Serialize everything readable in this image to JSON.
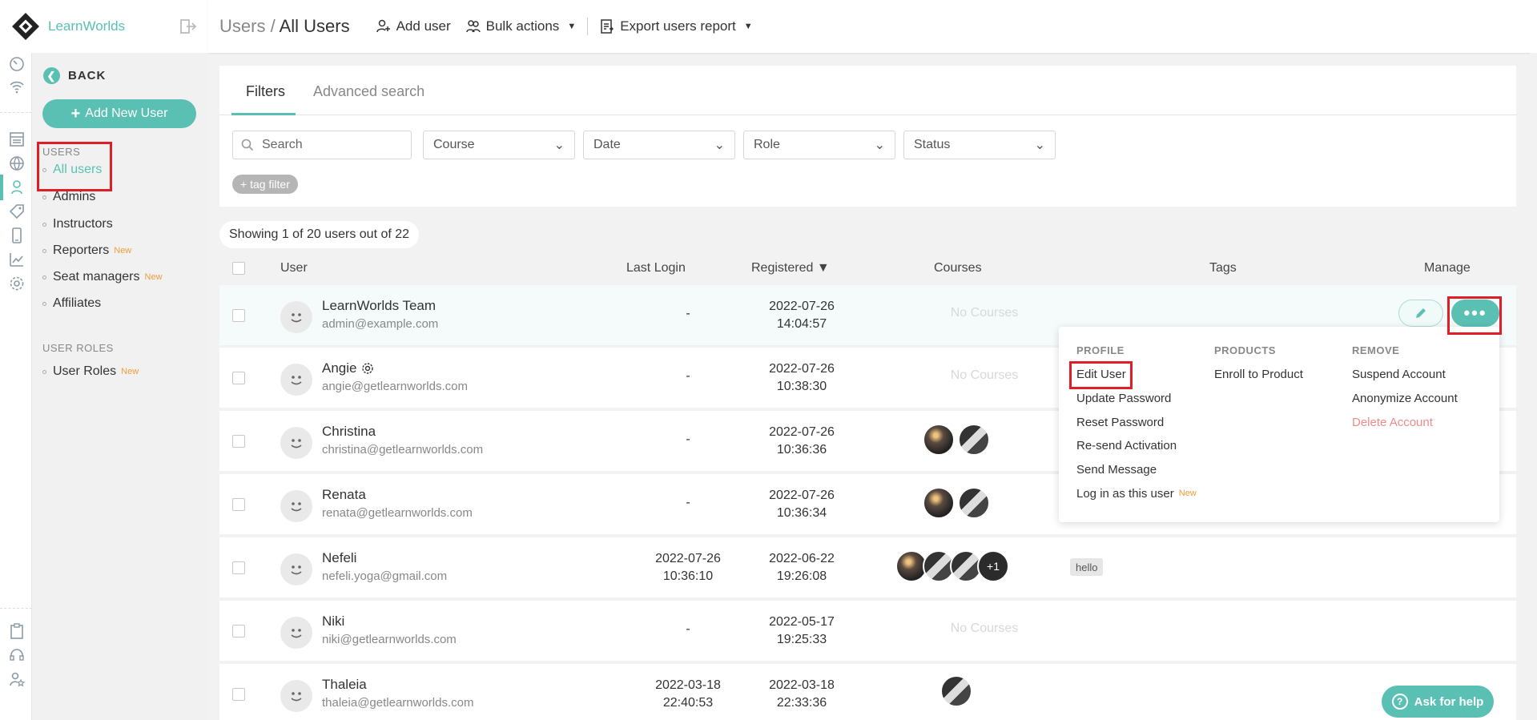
{
  "brand": {
    "name": "LearnWorlds"
  },
  "header": {
    "crumb_parent": "Users",
    "crumb_sep": " / ",
    "crumb_current": "All Users",
    "add_user": "Add user",
    "bulk_actions": "Bulk actions",
    "export_report": "Export users report"
  },
  "sidebar": {
    "back": "BACK",
    "add_new_user": "Add New User",
    "users_section": "USERS",
    "items": [
      {
        "label": "All users",
        "badge": ""
      },
      {
        "label": "Admins",
        "badge": ""
      },
      {
        "label": "Instructors",
        "badge": ""
      },
      {
        "label": "Reporters",
        "badge": "New"
      },
      {
        "label": "Seat managers",
        "badge": "New"
      },
      {
        "label": "Affiliates",
        "badge": ""
      }
    ],
    "roles_section": "USER ROLES",
    "roles_item": {
      "label": "User Roles",
      "badge": "New"
    }
  },
  "filters": {
    "tab_filters": "Filters",
    "tab_advanced": "Advanced search",
    "search_placeholder": "Search",
    "course": "Course",
    "date": "Date",
    "role": "Role",
    "status": "Status",
    "tag_filter": "+ tag filter"
  },
  "showing": "Showing 1 of 20 users out of 22",
  "table": {
    "columns": {
      "user": "User",
      "last_login": "Last Login",
      "registered": "Registered ▼",
      "courses": "Courses",
      "tags": "Tags",
      "manage": "Manage"
    },
    "no_courses": "No Courses",
    "rows": [
      {
        "name": "LearnWorlds Team",
        "email": "admin@example.com",
        "last_login_date": "-",
        "last_login_time": "",
        "reg_date": "2022-07-26",
        "reg_time": "14:04:57",
        "courses": 0,
        "tag": ""
      },
      {
        "name": "Angie",
        "email": "angie@getlearnworlds.com",
        "last_login_date": "-",
        "last_login_time": "",
        "reg_date": "2022-07-26",
        "reg_time": "10:38:30",
        "courses": 0,
        "tag": ""
      },
      {
        "name": "Christina",
        "email": "christina@getlearnworlds.com",
        "last_login_date": "-",
        "last_login_time": "",
        "reg_date": "2022-07-26",
        "reg_time": "10:36:36",
        "courses": 2,
        "tag": ""
      },
      {
        "name": "Renata",
        "email": "renata@getlearnworlds.com",
        "last_login_date": "-",
        "last_login_time": "",
        "reg_date": "2022-07-26",
        "reg_time": "10:36:34",
        "courses": 2,
        "tag": ""
      },
      {
        "name": "Nefeli",
        "email": "nefeli.yoga@gmail.com",
        "last_login_date": "2022-07-26",
        "last_login_time": "10:36:10",
        "reg_date": "2022-06-22",
        "reg_time": "19:26:08",
        "courses": 4,
        "more": "+1",
        "tag": "hello"
      },
      {
        "name": "Niki",
        "email": "niki@getlearnworlds.com",
        "last_login_date": "-",
        "last_login_time": "",
        "reg_date": "2022-05-17",
        "reg_time": "19:25:33",
        "courses": 0,
        "tag": ""
      },
      {
        "name": "Thaleia",
        "email": "thaleia@getlearnworlds.com",
        "last_login_date": "2022-03-18",
        "last_login_time": "22:40:53",
        "reg_date": "2022-03-18",
        "reg_time": "22:33:36",
        "courses": 1,
        "tag": ""
      }
    ]
  },
  "menu": {
    "profile": {
      "title": "PROFILE",
      "items": [
        "Edit User",
        "Update Password",
        "Reset Password",
        "Re-send Activation",
        "Send Message",
        "Log in as this user"
      ],
      "badge": "New"
    },
    "products": {
      "title": "PRODUCTS",
      "items": [
        "Enroll to Product"
      ]
    },
    "remove": {
      "title": "REMOVE",
      "items": [
        "Suspend Account",
        "Anonymize Account",
        "Delete Account"
      ]
    }
  },
  "help": {
    "label": "Ask for help"
  },
  "colors": {
    "accent": "#5bc0b4",
    "highlight": "#e01e25",
    "new_badge": "#f39c3c",
    "danger": "#f08a8a"
  }
}
